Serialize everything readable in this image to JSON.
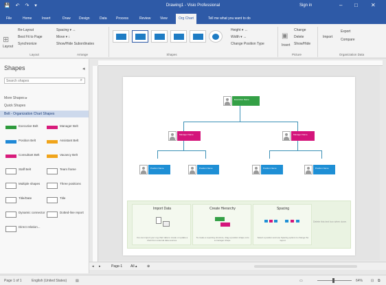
{
  "window": {
    "title": "Drawing1 - Visio Professional",
    "signin": "Sign in",
    "minimize": "–",
    "restore": "□",
    "close": "✕",
    "quick_access": "💾 ↶ ↷ ▾"
  },
  "tabs": [
    "File",
    "Home",
    "Insert",
    "Draw",
    "Design",
    "Data",
    "Process",
    "Review",
    "View",
    "Org Chart"
  ],
  "active_tab": "Org Chart",
  "tell_me": "Tell me what you want to do",
  "ribbon": {
    "layout": {
      "button": "Layout",
      "items": [
        "Re-Layout",
        "Best Fit to Page",
        "Synchronize"
      ],
      "spacing": "Spacing ▾ ↔",
      "move": "Move ▾ ↕",
      "show_hide": "Show/Hide Subordinates",
      "group": "Layout"
    },
    "arrange_group": "Arrange",
    "shapes_group": "Shapes",
    "shape_opts": [
      "Height ▾ ↔",
      "Width ▾ ↔",
      "Change Position Type"
    ],
    "picture": {
      "insert": "Insert",
      "items": [
        "Change",
        "Delete",
        "Show/Hide"
      ],
      "group": "Picture"
    },
    "org_data": {
      "items": [
        "Import",
        "Export",
        "Compare"
      ],
      "group": "Organization Data"
    }
  },
  "sidebar": {
    "heading": "Shapes",
    "search_placeholder": "Search shapes",
    "more_shapes": "More Shapes ▸",
    "quick_shapes": "Quick Shapes",
    "active_stencil": "Belt - Organization Chart Shapes",
    "items": [
      {
        "label": "Executive Belt",
        "color": "#2e9a3c"
      },
      {
        "label": "Manager Belt",
        "color": "#d81b7b"
      },
      {
        "label": "Position Belt",
        "color": "#1e88d6"
      },
      {
        "label": "Assistant Belt",
        "color": "#f0a41a"
      },
      {
        "label": "Consultant Belt",
        "color": "#d81b7b"
      },
      {
        "label": "Vacancy Belt",
        "color": "#f0a41a"
      },
      {
        "label": "Staff Belt",
        "color": "#888888"
      },
      {
        "label": "Team frame",
        "color": "#888888"
      },
      {
        "label": "Multiple shapes",
        "color": "#888888"
      },
      {
        "label": "Three positions",
        "color": "#888888"
      },
      {
        "label": "Title/Date",
        "color": "#888888"
      },
      {
        "label": "Title",
        "color": "#888888"
      },
      {
        "label": "Dynamic connector",
        "color": "#888888"
      },
      {
        "label": "Dotted-line report",
        "color": "#888888"
      },
      {
        "label": "Direct relation...",
        "color": "#888888"
      }
    ]
  },
  "org_chart": {
    "colors": {
      "executive": "#34a046",
      "manager": "#d4157b",
      "position": "#1e8fd5"
    },
    "executive": {
      "title": "Executive Name"
    },
    "managers": [
      {
        "title": "Manager Name"
      },
      {
        "title": "Manager Name"
      }
    ],
    "positions": [
      {
        "title": "Position Name"
      },
      {
        "title": "Position Name"
      },
      {
        "title": "Position Name"
      },
      {
        "title": "Position Name"
      }
    ]
  },
  "tips": [
    {
      "title": "Import Data",
      "body": "You can import your org chart data to create or update a chart from external data sources."
    },
    {
      "title": "Create Hierarchy",
      "body": "To create a reporting structure, drag a position shape onto a manager shape."
    },
    {
      "title": "Spacing",
      "body": "Select a position and use Spacing options to change the layout."
    }
  ],
  "tips_extra": "Delete this text box when done.",
  "pagetabs": {
    "page": "Page-1",
    "all": "All ▴",
    "add": "⊕",
    "prev": "◂",
    "next": "▸"
  },
  "status": {
    "left": "Page 1 of 1",
    "language": "English (United States)",
    "zoom": "64%"
  }
}
